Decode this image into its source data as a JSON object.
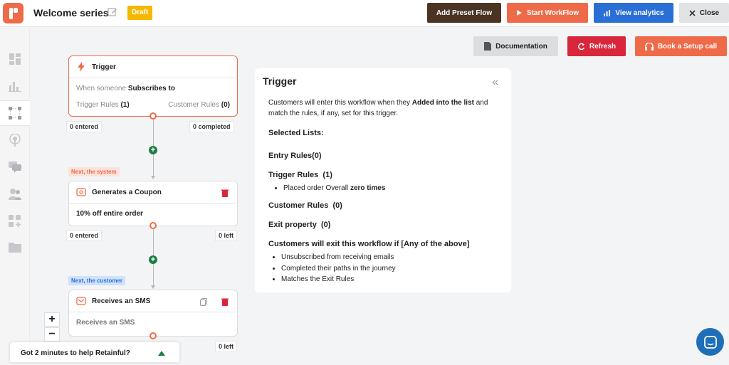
{
  "header": {
    "title": "Welcome series",
    "status_badge": "Draft",
    "buttons": {
      "add_preset": "Add Preset Flow",
      "start": "Start WorkFlow",
      "analytics": "View analytics",
      "close": "Close"
    }
  },
  "toolbar": {
    "documentation": "Documentation",
    "refresh": "Refresh",
    "setup_call": "Book a Setup call"
  },
  "sidebar": {
    "items": [
      "dashboard-icon",
      "analytics-icon",
      "workflow-icon",
      "broadcast-icon",
      "messages-icon",
      "contacts-icon",
      "integrations-icon",
      "folder-icon"
    ],
    "active": "workflow-icon"
  },
  "flow": {
    "trigger": {
      "title": "Trigger",
      "line_prefix": "When someone",
      "line_bold": "Subscribes to",
      "trigger_rules_label": "Trigger Rules",
      "trigger_rules_count": "(1)",
      "customer_rules_label": "Customer Rules",
      "customer_rules_count": "(0)",
      "entered": "0 entered",
      "completed": "0 completed"
    },
    "coupon": {
      "tag": "Next, the system",
      "title": "Generates a Coupon",
      "body": "10% off entire order",
      "entered": "0 entered",
      "left": "0 left"
    },
    "sms": {
      "tag": "Next, the customer",
      "title": "Receives an SMS",
      "body": "Receives an SMS",
      "left": "0 left"
    }
  },
  "panel": {
    "title": "Trigger",
    "intro_1": "Customers will enter this workflow when they",
    "intro_bold": "Added into the list",
    "intro_2": "and",
    "intro_3": "match the rules, if any, set for this trigger.",
    "selected_lists": "Selected Lists:",
    "entry_rules": "Entry Rules(0)",
    "trigger_rules": "Trigger Rules  (1)",
    "trigger_rule_item_prefix": "Placed order Overall",
    "trigger_rule_item_bold": "zero times",
    "customer_rules": "Customer Rules  (0)",
    "exit_property": "Exit property  (0)",
    "exit_heading": "Customers will exit this workflow if [Any of the above]",
    "exit_items": [
      "Unsubscribed from receiving emails",
      "Completed their paths in the journey",
      "Matches the Exit Rules"
    ]
  },
  "zoom": {
    "in": "+",
    "out": "−"
  },
  "feedback": {
    "text": "Got 2 minutes to help Retainful?"
  },
  "colors": {
    "brand": "#ef6a48",
    "primary_blue": "#2a6fd6",
    "danger": "#d9263a",
    "success": "#1d7f44",
    "draft": "#f5b800"
  }
}
